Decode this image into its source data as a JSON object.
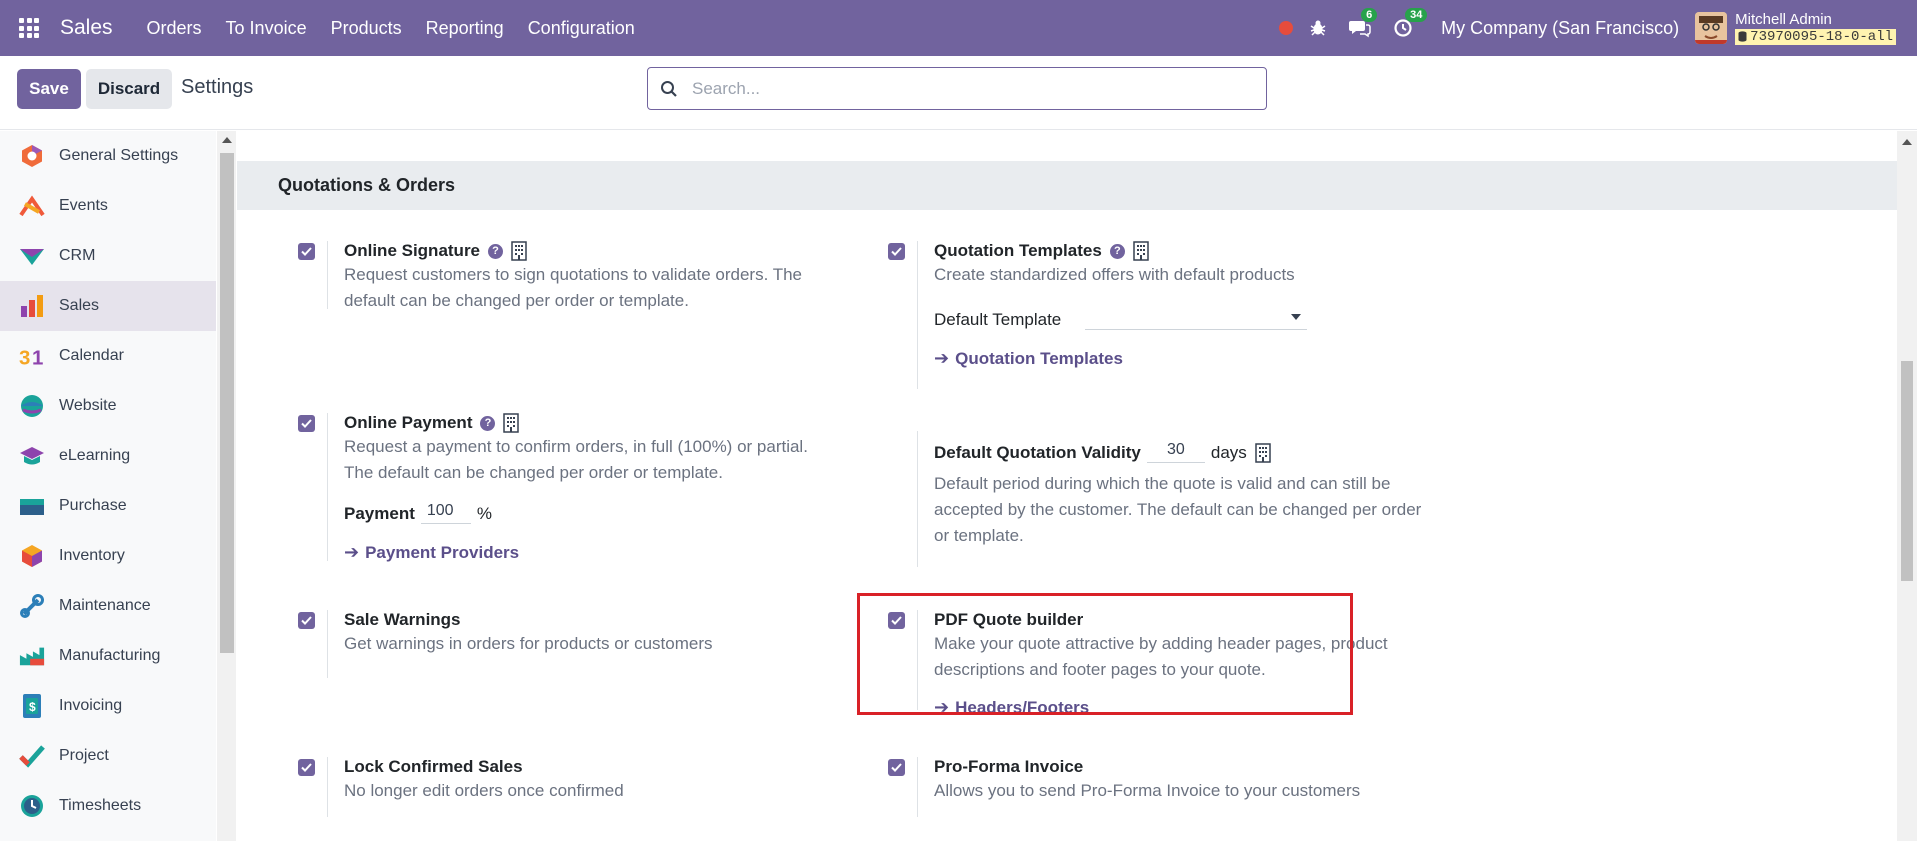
{
  "navbar": {
    "brand": "Sales",
    "menu": [
      "Orders",
      "To Invoice",
      "Products",
      "Reporting",
      "Configuration"
    ],
    "messages_count": "6",
    "activities_count": "34",
    "company": "My Company (San Francisco)",
    "user_name": "Mitchell Admin",
    "db_name": "73970095-18-0-all"
  },
  "control": {
    "save_label": "Save",
    "discard_label": "Discard",
    "title": "Settings",
    "search_placeholder": "Search..."
  },
  "sidebar": {
    "items": [
      {
        "label": "General Settings",
        "icon": "general-settings-icon"
      },
      {
        "label": "Events",
        "icon": "events-icon"
      },
      {
        "label": "CRM",
        "icon": "crm-icon"
      },
      {
        "label": "Sales",
        "icon": "sales-icon",
        "active": true
      },
      {
        "label": "Calendar",
        "icon": "calendar-icon"
      },
      {
        "label": "Website",
        "icon": "website-icon"
      },
      {
        "label": "eLearning",
        "icon": "elearning-icon"
      },
      {
        "label": "Purchase",
        "icon": "purchase-icon"
      },
      {
        "label": "Inventory",
        "icon": "inventory-icon"
      },
      {
        "label": "Maintenance",
        "icon": "maintenance-icon"
      },
      {
        "label": "Manufacturing",
        "icon": "manufacturing-icon"
      },
      {
        "label": "Invoicing",
        "icon": "invoicing-icon"
      },
      {
        "label": "Project",
        "icon": "project-icon"
      },
      {
        "label": "Timesheets",
        "icon": "timesheets-icon"
      }
    ]
  },
  "section": {
    "title": "Quotations & Orders"
  },
  "settings": {
    "online_signature": {
      "title": "Online Signature",
      "desc1": "Request customers to sign quotations to validate orders. The",
      "desc2": "default can be changed per order or template.",
      "checked": true
    },
    "quotation_templates": {
      "title": "Quotation Templates",
      "desc": "Create standardized offers with default products",
      "field_label": "Default Template",
      "field_value": "",
      "link": "Quotation Templates",
      "checked": true
    },
    "online_payment": {
      "title": "Online Payment",
      "desc1": "Request a payment to confirm orders, in full (100%) or partial.",
      "desc2": "The default can be changed per order or template.",
      "field_label": "Payment",
      "field_value": "100",
      "field_unit": "%",
      "link": "Payment Providers",
      "checked": true
    },
    "quotation_validity": {
      "title": "Default Quotation Validity",
      "field_value": "30",
      "field_unit": "days",
      "desc1": "Default period during which the quote is valid and can still be",
      "desc2": "accepted by the customer. The default can be changed per order",
      "desc3": "or template."
    },
    "sale_warnings": {
      "title": "Sale Warnings",
      "desc": "Get warnings in orders for products or customers",
      "checked": true
    },
    "pdf_quote_builder": {
      "title": "PDF Quote builder",
      "desc1": "Make your quote attractive by adding header pages, product",
      "desc2": "descriptions and footer pages to your quote.",
      "link": "Headers/Footers",
      "checked": true
    },
    "lock_confirmed_sales": {
      "title": "Lock Confirmed Sales",
      "desc": "No longer edit orders once confirmed",
      "checked": true
    },
    "pro_forma_invoice": {
      "title": "Pro-Forma Invoice",
      "desc": "Allows you to send Pro-Forma Invoice to your customers",
      "checked": true
    }
  },
  "colors": {
    "primary": "#71639e",
    "highlight": "#d92127",
    "badge_green": "#27a24b"
  }
}
